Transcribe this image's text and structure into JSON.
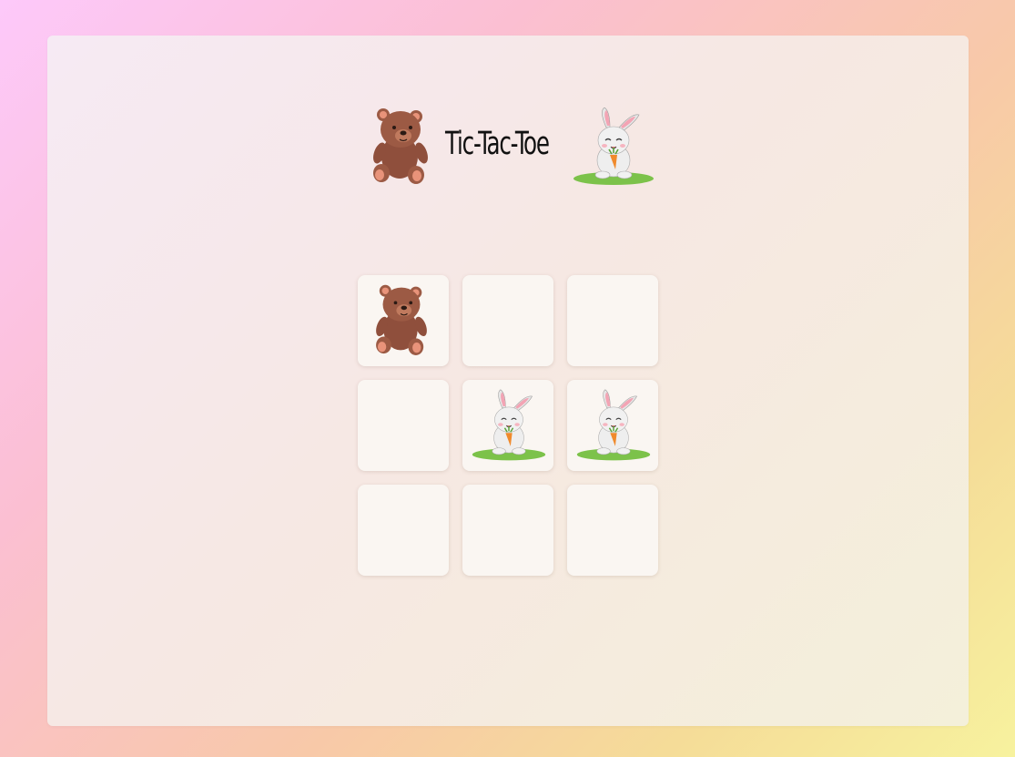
{
  "title": "Tic-Tac-Toe",
  "players": {
    "x": "bear",
    "o": "bunny"
  },
  "board": [
    [
      "bear",
      "",
      ""
    ],
    [
      "",
      "bunny",
      "bunny"
    ],
    [
      "",
      "",
      ""
    ]
  ],
  "colors": {
    "background_gradient": [
      "#fdc9fa",
      "#fbbfd2",
      "#f8c9a8",
      "#f5dc98",
      "#f7f29e"
    ],
    "cell": "#faf6f2",
    "bear": "#9c5a44",
    "bunny": "#e9e9e9",
    "grass": "#7cc24a"
  },
  "icons": {
    "bear": "teddy-bear-icon",
    "bunny": "bunny-icon"
  }
}
